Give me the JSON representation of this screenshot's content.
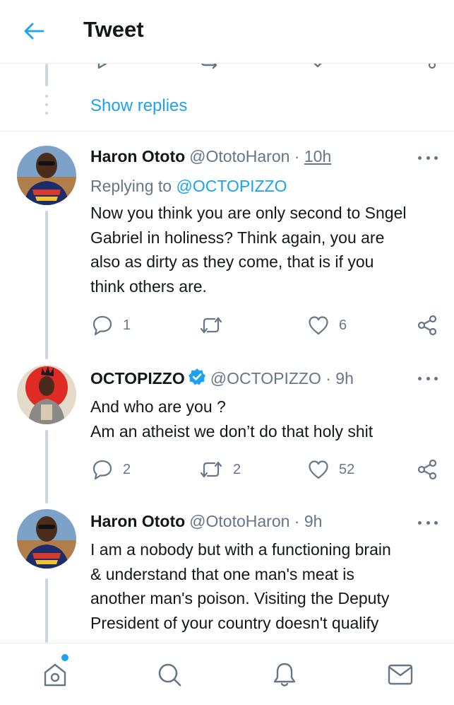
{
  "header": {
    "title": "Tweet"
  },
  "thread": {
    "show_replies_label": "Show replies"
  },
  "tweets": [
    {
      "name": "Haron Ototo",
      "handle": "@OtotoHaron",
      "sep": "·",
      "time": "10h",
      "replying_prefix": "Replying to",
      "replying_to": "@OCTOPIZZO",
      "lines": [
        "Now you think you are only second to Sngel",
        "Gabriel in holiness? Think again, you are",
        "also as dirty as they come, that is if you",
        "think others are."
      ],
      "replies": "1",
      "retweets": "",
      "likes": "6"
    },
    {
      "name": "OCTOPIZZO",
      "verified": true,
      "handle": "@OCTOPIZZO",
      "sep": "·",
      "time": "9h",
      "lines": [
        "And who are you ?",
        "Am an atheist we don’t do that holy shit"
      ],
      "replies": "2",
      "retweets": "2",
      "likes": "52"
    },
    {
      "name": "Haron Ototo",
      "handle": "@OtotoHaron",
      "sep": "·",
      "time": "9h",
      "lines": [
        "I am a nobody but with a functioning brain",
        "& understand that one man's meat is",
        "another man's poison. Visiting the Deputy",
        "President of your country doesn't qualify"
      ]
    }
  ],
  "icons": {
    "back": "arrow-left-icon",
    "reply": "reply-bubble-icon",
    "retweet": "retweet-icon",
    "like": "heart-icon",
    "share": "share-icon",
    "more": "more-dots-icon",
    "verified": "verified-badge-icon",
    "home": "home-icon",
    "search": "search-icon",
    "notifications": "bell-icon",
    "messages": "mail-icon"
  },
  "colors": {
    "accent": "#1da1f2",
    "text": "#14171a",
    "muted": "#657786",
    "divider": "#e6ecf0",
    "thread_line": "#ccd6dd"
  }
}
